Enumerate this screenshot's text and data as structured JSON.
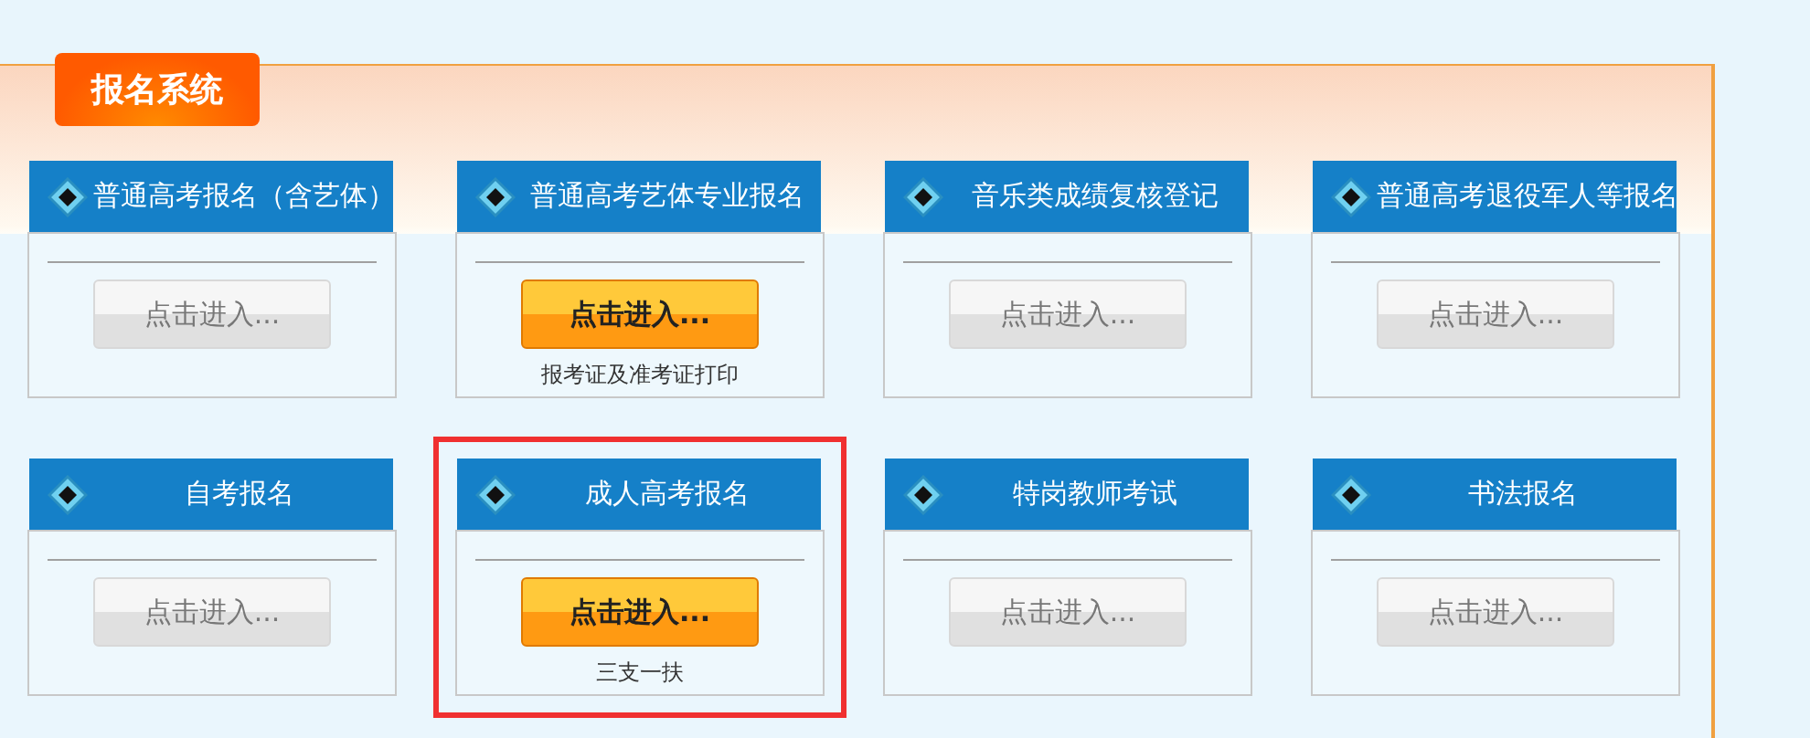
{
  "panel": {
    "title": "报名系统"
  },
  "cards": [
    {
      "title": "普通高考报名（含艺体）",
      "button": "点击进入...",
      "active": false,
      "highlighted": false
    },
    {
      "title": "普通高考艺体专业报名",
      "button": "点击进入...",
      "active": true,
      "note": "报考证及准考证打印",
      "highlighted": false
    },
    {
      "title": "音乐类成绩复核登记",
      "button": "点击进入...",
      "active": false,
      "highlighted": false
    },
    {
      "title": "普通高考退役军人等报名",
      "button": "点击进入...",
      "active": false,
      "highlighted": false
    },
    {
      "title": "自考报名",
      "button": "点击进入...",
      "active": false,
      "highlighted": false
    },
    {
      "title": "成人高考报名",
      "button": "点击进入...",
      "active": true,
      "note": "三支一扶",
      "highlighted": true
    },
    {
      "title": "特岗教师考试",
      "button": "点击进入...",
      "active": false,
      "highlighted": false
    },
    {
      "title": "书法报名",
      "button": "点击进入...",
      "active": false,
      "highlighted": false
    }
  ]
}
